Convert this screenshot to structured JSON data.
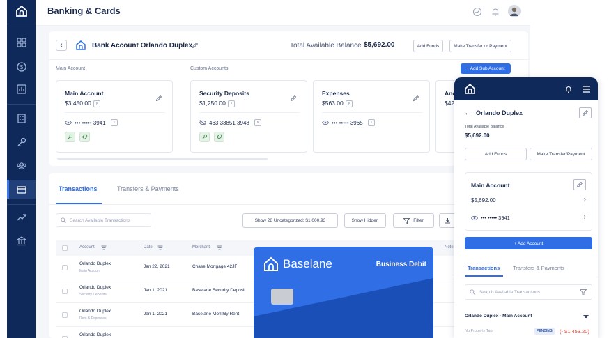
{
  "header": {
    "title": "Banking & Cards"
  },
  "account": {
    "title": "Bank Account Orlando Duplex",
    "total_label": "Total Available Balance",
    "total_value": "$5,692.00",
    "add_funds": "Add Funds",
    "make_transfer": "Make Transfer or Payment",
    "main_account_label": "Main Account",
    "custom_accounts_label": "Custom Accounts",
    "add_sub_account": "+ Add Sub Account"
  },
  "accounts": [
    {
      "name": "Main Account",
      "balance": "$3,450.00",
      "number": "••• ••••• 3941"
    },
    {
      "name": "Security Deposits",
      "balance": "$1,250.00",
      "number": "463 33851 3948"
    },
    {
      "name": "Expenses",
      "balance": "$563.00",
      "number": "••• ••••• 3965"
    },
    {
      "name": "And",
      "balance": "$42"
    }
  ],
  "transactions": {
    "tab_active": "Transactions",
    "tab_inactive": "Transfers & Payments",
    "search_placeholder": "Search Available Transactions",
    "uncategorized_btn": "Show 28 Uncategorized: $1,000.93",
    "show_hidden_btn": "Show Hidden",
    "filter_btn": "Filter",
    "columns": {
      "account": "Account",
      "date": "Date",
      "merchant": "Merchant",
      "notes": "Note"
    },
    "rows": [
      {
        "account": "Orlando Duplex",
        "sub": "Main Account",
        "date": "Jan 22, 2021",
        "merchant": "Chase Mortgage 42JF"
      },
      {
        "account": "Orlando Duplex",
        "sub": "Security Deposits",
        "date": "Jan 1, 2021",
        "merchant": "Baselane Security Deposit"
      },
      {
        "account": "Orlando Duplex",
        "sub": "Rent & Expenses",
        "date": "Jan 1, 2021",
        "merchant": "Baselane Monthly Rent"
      },
      {
        "account": "Orlando Duplex",
        "sub": ""
      }
    ]
  },
  "card": {
    "brand": "Baselane",
    "type": "Business Debit"
  },
  "mobile": {
    "title": "Orlando Duplex",
    "balance_label": "Total Available Balance",
    "balance": "$5,692.00",
    "add_funds": "Add Funds",
    "make_transfer": "Make Transfer/Payment",
    "account_name": "Main Account",
    "account_balance": "$5,692.00",
    "account_number": "••• ••••• 3941",
    "add_account": "+ Add Account",
    "tab_active": "Transactions",
    "tab_inactive": "Transfers & Payments",
    "search_placeholder": "Search Available Transactions",
    "row_title": "Orlando Duplex - Main Account",
    "row_sub": "No Property Tag",
    "row_status": "PENDING",
    "row_amount": "(- $1,453.20)"
  },
  "colors": {
    "navy": "#0f2a5a",
    "accent": "#2f6ee5",
    "negative": "#d9433b"
  }
}
